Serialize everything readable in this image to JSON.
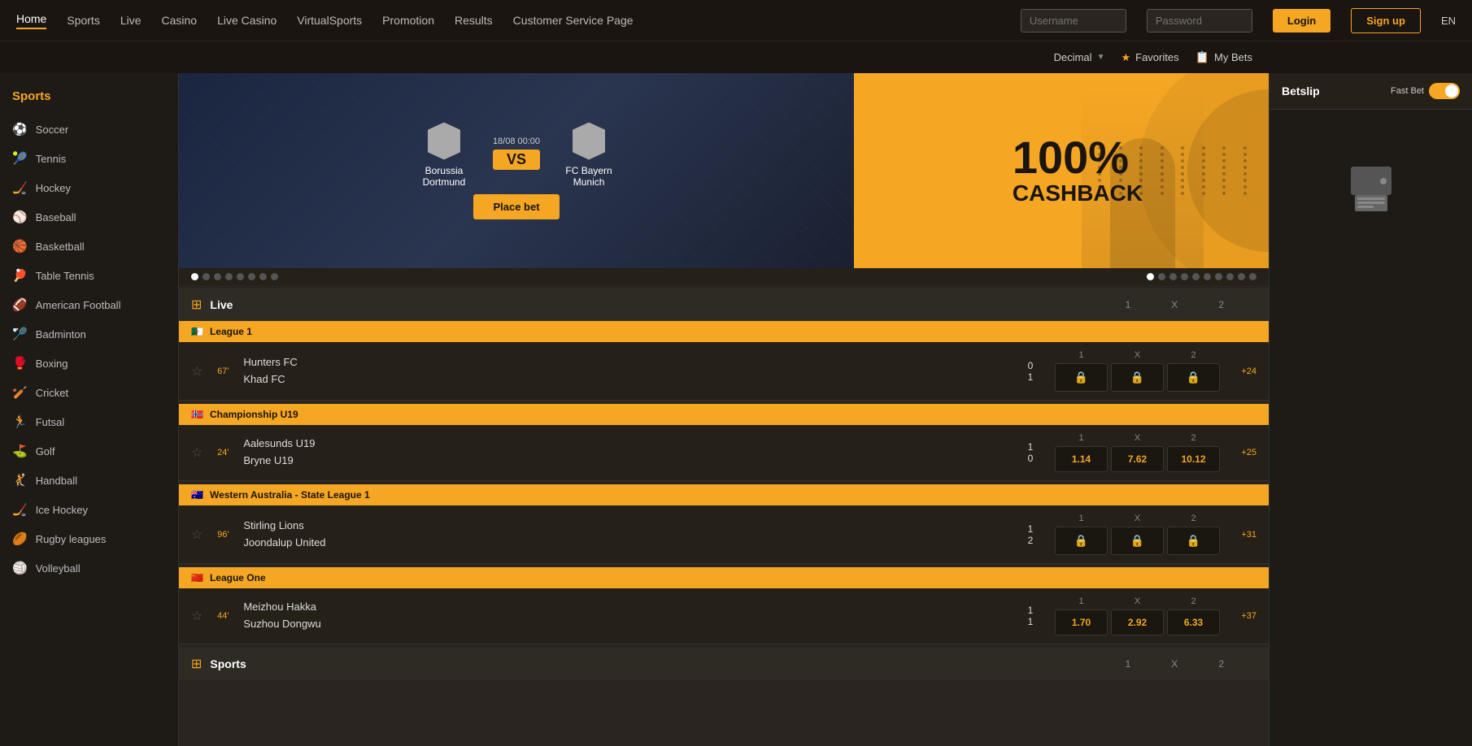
{
  "nav": {
    "items": [
      {
        "label": "Home",
        "active": true
      },
      {
        "label": "Sports"
      },
      {
        "label": "Live"
      },
      {
        "label": "Casino"
      },
      {
        "label": "Live Casino"
      },
      {
        "label": "VirtualSports"
      },
      {
        "label": "Promotion"
      },
      {
        "label": "Results"
      },
      {
        "label": "Customer Service Page"
      }
    ],
    "username_placeholder": "Username",
    "password_placeholder": "Password",
    "login_label": "Login",
    "signup_label": "Sign up",
    "lang": "EN"
  },
  "secondary_nav": {
    "decimal_label": "Decimal",
    "favorites_label": "Favorites",
    "mybets_label": "My Bets"
  },
  "sidebar": {
    "title": "Sports",
    "items": [
      {
        "label": "Soccer",
        "icon": "⚽"
      },
      {
        "label": "Tennis",
        "icon": "🎾"
      },
      {
        "label": "Hockey",
        "icon": "🏒"
      },
      {
        "label": "Baseball",
        "icon": "⚾"
      },
      {
        "label": "Basketball",
        "icon": "🏀"
      },
      {
        "label": "Table Tennis",
        "icon": "🏓"
      },
      {
        "label": "American Football",
        "icon": "🏈"
      },
      {
        "label": "Badminton",
        "icon": "🏸"
      },
      {
        "label": "Boxing",
        "icon": "🥊"
      },
      {
        "label": "Cricket",
        "icon": "🏏"
      },
      {
        "label": "Futsal",
        "icon": "🏃"
      },
      {
        "label": "Golf",
        "icon": "⛳"
      },
      {
        "label": "Handball",
        "icon": "🤾"
      },
      {
        "label": "Ice Hockey",
        "icon": "🏒"
      },
      {
        "label": "Rugby leagues",
        "icon": "🏉"
      },
      {
        "label": "Volleyball",
        "icon": "🏐"
      }
    ]
  },
  "banner": {
    "date": "18/08 00:00",
    "team1": "Borussia Dortmund",
    "team2": "FC Bayern Munich",
    "vs_label": "VS",
    "place_bet": "Place bet",
    "promo_line1": "100%",
    "promo_line2": "CASHBACK",
    "dots_main": 8,
    "dots_promo": 10,
    "active_dot_main": 0,
    "active_dot_promo": 0
  },
  "live_section": {
    "title": "Live",
    "label_1": "1",
    "label_x": "X",
    "label_2": "2"
  },
  "sports_section": {
    "title": "Sports",
    "label_1": "1",
    "label_x": "X",
    "label_2": "2"
  },
  "leagues": [
    {
      "name": "League 1",
      "flag": "🇩🇿",
      "matches": [
        {
          "star": "☆",
          "time": "67'",
          "team1": "Hunters FC",
          "team2": "Khad FC",
          "score1": "0",
          "score2": "1",
          "odds1": "🔒",
          "oddsx": "🔒",
          "odds2": "🔒",
          "locked": true,
          "more": "+24"
        }
      ]
    },
    {
      "name": "Championship U19",
      "flag": "🇳🇴",
      "matches": [
        {
          "star": "☆",
          "time": "24'",
          "team1": "Aalesunds U19",
          "team2": "Bryne U19",
          "score1": "1",
          "score2": "0",
          "odds1": "1.14",
          "oddsx": "7.62",
          "odds2": "10.12",
          "locked": false,
          "more": "+25"
        }
      ]
    },
    {
      "name": "Western Australia - State League 1",
      "flag": "🇦🇺",
      "matches": [
        {
          "star": "☆",
          "time": "96'",
          "team1": "Stirling Lions",
          "team2": "Joondalup United",
          "score1": "1",
          "score2": "2",
          "odds1": "🔒",
          "oddsx": "🔒",
          "odds2": "🔒",
          "locked": true,
          "more": "+31"
        }
      ]
    },
    {
      "name": "League One",
      "flag": "🇨🇳",
      "matches": [
        {
          "star": "☆",
          "time": "44'",
          "team1": "Meizhou Hakka",
          "team2": "Suzhou Dongwu",
          "score1": "1",
          "score2": "1",
          "odds1": "1.70",
          "oddsx": "2.92",
          "odds2": "6.33",
          "locked": false,
          "more": "+37"
        }
      ]
    }
  ],
  "betslip": {
    "title": "Betslip",
    "fast_bet_label": "Fast Bet"
  }
}
